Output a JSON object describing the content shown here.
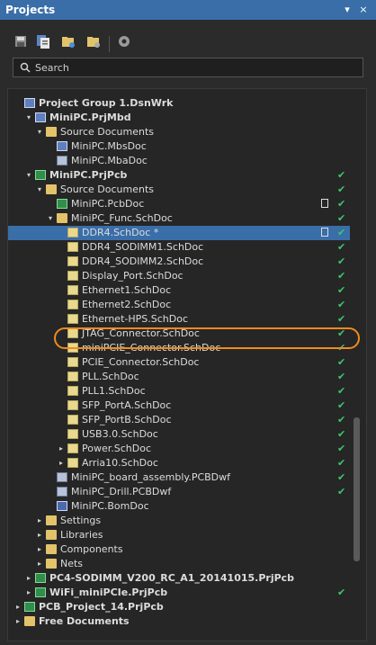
{
  "panel_title": "Projects",
  "title_buttons": [
    "▾",
    "×"
  ],
  "toolbar_icons": [
    "save-icon",
    "save-all-icon",
    "open-folder-icon",
    "folder-settings-icon",
    "gear-icon"
  ],
  "search": {
    "label": "Search",
    "icon": "search-icon"
  },
  "tree": [
    {
      "label": "Project Group 1.DsnWrk",
      "bold": true,
      "depth": 0,
      "arrow": "",
      "icon": "group",
      "check": false
    },
    {
      "label": "MiniPC.PrjMbd",
      "bold": true,
      "depth": 1,
      "arrow": "▾",
      "icon": "proj",
      "check": false
    },
    {
      "label": "Source Documents",
      "bold": false,
      "depth": 2,
      "arrow": "▾",
      "icon": "folder",
      "check": false
    },
    {
      "label": "MiniPC.MbsDoc",
      "bold": false,
      "depth": 3,
      "arrow": "",
      "icon": "proj",
      "check": false
    },
    {
      "label": "MiniPC.MbaDoc",
      "bold": false,
      "depth": 3,
      "arrow": "",
      "icon": "dwf",
      "check": false
    },
    {
      "label": "MiniPC.PrjPcb",
      "bold": true,
      "depth": 1,
      "arrow": "▾",
      "icon": "pcb",
      "check": true
    },
    {
      "label": "Source Documents",
      "bold": false,
      "depth": 2,
      "arrow": "▾",
      "icon": "folder",
      "check": true
    },
    {
      "label": "MiniPC.PcbDoc",
      "bold": false,
      "depth": 3,
      "arrow": "",
      "icon": "pcb",
      "check": true,
      "doc": true
    },
    {
      "label": "MiniPC_Func.SchDoc",
      "bold": false,
      "depth": 3,
      "arrow": "▾",
      "icon": "folder",
      "check": true
    },
    {
      "label": "DDR4.SchDoc *",
      "bold": false,
      "depth": 4,
      "arrow": "",
      "icon": "sch",
      "check": true,
      "selected": true,
      "doc": true
    },
    {
      "label": "DDR4_SODIMM1.SchDoc",
      "bold": false,
      "depth": 4,
      "arrow": "",
      "icon": "sch",
      "check": true
    },
    {
      "label": "DDR4_SODIMM2.SchDoc",
      "bold": false,
      "depth": 4,
      "arrow": "",
      "icon": "sch",
      "check": true
    },
    {
      "label": "Display_Port.SchDoc",
      "bold": false,
      "depth": 4,
      "arrow": "",
      "icon": "sch",
      "check": true
    },
    {
      "label": "Ethernet1.SchDoc",
      "bold": false,
      "depth": 4,
      "arrow": "",
      "icon": "sch",
      "check": true
    },
    {
      "label": "Ethernet2.SchDoc",
      "bold": false,
      "depth": 4,
      "arrow": "",
      "icon": "sch",
      "check": true
    },
    {
      "label": "Ethernet-HPS.SchDoc",
      "bold": false,
      "depth": 4,
      "arrow": "",
      "icon": "sch",
      "check": true,
      "highlight": true
    },
    {
      "label": "JTAG_Connector.SchDoc",
      "bold": false,
      "depth": 4,
      "arrow": "",
      "icon": "sch",
      "check": true
    },
    {
      "label": "miniPCIE_Connector.SchDoc",
      "bold": false,
      "depth": 4,
      "arrow": "",
      "icon": "sch",
      "check": true
    },
    {
      "label": "PCIE_Connector.SchDoc",
      "bold": false,
      "depth": 4,
      "arrow": "",
      "icon": "sch",
      "check": true
    },
    {
      "label": "PLL.SchDoc",
      "bold": false,
      "depth": 4,
      "arrow": "",
      "icon": "sch",
      "check": true
    },
    {
      "label": "PLL1.SchDoc",
      "bold": false,
      "depth": 4,
      "arrow": "",
      "icon": "sch",
      "check": true
    },
    {
      "label": "SFP_PortA.SchDoc",
      "bold": false,
      "depth": 4,
      "arrow": "",
      "icon": "sch",
      "check": true
    },
    {
      "label": "SFP_PortB.SchDoc",
      "bold": false,
      "depth": 4,
      "arrow": "",
      "icon": "sch",
      "check": true
    },
    {
      "label": "USB3.0.SchDoc",
      "bold": false,
      "depth": 4,
      "arrow": "",
      "icon": "sch",
      "check": true
    },
    {
      "label": "Power.SchDoc",
      "bold": false,
      "depth": 4,
      "arrow": "▸",
      "icon": "sch",
      "check": true
    },
    {
      "label": "Arria10.SchDoc",
      "bold": false,
      "depth": 4,
      "arrow": "▸",
      "icon": "sch",
      "check": true
    },
    {
      "label": "MiniPC_board_assembly.PCBDwf",
      "bold": false,
      "depth": 3,
      "arrow": "",
      "icon": "dwf",
      "check": true
    },
    {
      "label": "MiniPC_Drill.PCBDwf",
      "bold": false,
      "depth": 3,
      "arrow": "",
      "icon": "dwf",
      "check": true
    },
    {
      "label": "MiniPC.BomDoc",
      "bold": false,
      "depth": 3,
      "arrow": "",
      "icon": "bom",
      "check": false
    },
    {
      "label": "Settings",
      "bold": false,
      "depth": 2,
      "arrow": "▸",
      "icon": "folder",
      "check": false
    },
    {
      "label": "Libraries",
      "bold": false,
      "depth": 2,
      "arrow": "▸",
      "icon": "folder",
      "check": false
    },
    {
      "label": "Components",
      "bold": false,
      "depth": 2,
      "arrow": "▸",
      "icon": "folder",
      "check": false
    },
    {
      "label": "Nets",
      "bold": false,
      "depth": 2,
      "arrow": "▸",
      "icon": "folder",
      "check": false
    },
    {
      "label": "PC4-SODIMM_V200_RC_A1_20141015.PrjPcb",
      "bold": true,
      "depth": 1,
      "arrow": "▸",
      "icon": "pcb",
      "check": false
    },
    {
      "label": "WiFi_miniPCIe.PrjPcb",
      "bold": true,
      "depth": 1,
      "arrow": "▸",
      "icon": "pcb",
      "check": true
    },
    {
      "label": "PCB_Project_14.PrjPcb",
      "bold": true,
      "depth": 0,
      "arrow": "▸",
      "icon": "pcb",
      "check": false
    },
    {
      "label": "Free Documents",
      "bold": true,
      "depth": 0,
      "arrow": "▸",
      "icon": "folder",
      "check": false
    }
  ]
}
